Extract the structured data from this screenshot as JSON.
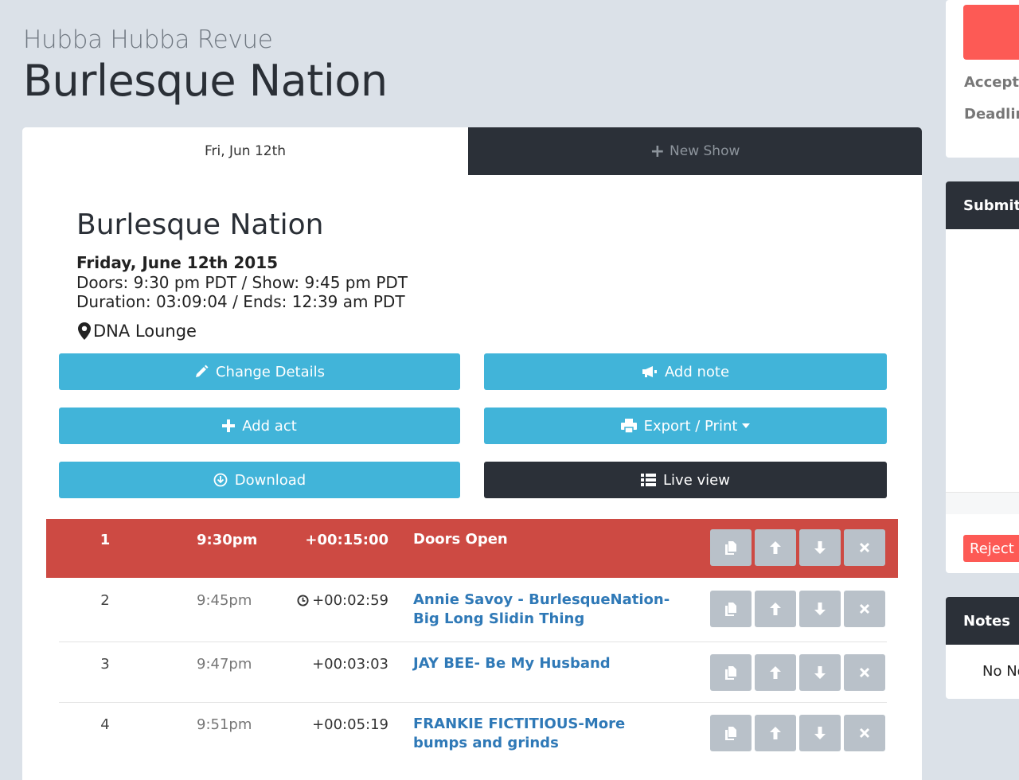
{
  "header": {
    "subtitle": "Hubba Hubba Revue",
    "title": "Burlesque Nation"
  },
  "tabs": [
    {
      "label": "Fri, Jun 12th",
      "active": true
    },
    {
      "label": "New Show",
      "icon": "plus-icon"
    }
  ],
  "show": {
    "name": "Burlesque Nation",
    "date": "Friday, June 12th 2015",
    "times": "Doors: 9:30 pm PDT / Show: 9:45 pm PDT",
    "duration": "Duration: 03:09:04 / Ends: 12:39 am PDT",
    "venue": "DNA Lounge"
  },
  "buttons": {
    "change_details": "Change Details",
    "add_note": "Add note",
    "add_act": "Add act",
    "export_print": "Export / Print",
    "download": "Download",
    "live_view": "Live view"
  },
  "schedule": [
    {
      "num": "1",
      "time": "9:30pm",
      "duration": "+00:15:00",
      "title": "Doors Open",
      "highlight": true
    },
    {
      "num": "2",
      "time": "9:45pm",
      "duration": "+00:02:59",
      "title": "Annie Savoy - BurlesqueNation- Big Long Slidin Thing",
      "timer_icon": true
    },
    {
      "num": "3",
      "time": "9:47pm",
      "duration": "+00:03:03",
      "title": "JAY BEE- Be My Husband"
    },
    {
      "num": "4",
      "time": "9:51pm",
      "duration": "+00:05:19",
      "title": "FRANKIE FICTITIOUS-More bumps and grinds"
    }
  ],
  "sidebar": {
    "accepting": "Acceptin",
    "deadline": "Deadlin",
    "submitted_header": "Submitte",
    "reject_label": "Reject S",
    "notes_header": "Notes",
    "notes_empty": "No No"
  },
  "colors": {
    "accent": "#41b4d9",
    "dark": "#2b3038",
    "highlight_row": "#cd4a43",
    "link": "#2f79b7",
    "danger": "#fd5a55",
    "page_bg": "#dbe1e8"
  }
}
